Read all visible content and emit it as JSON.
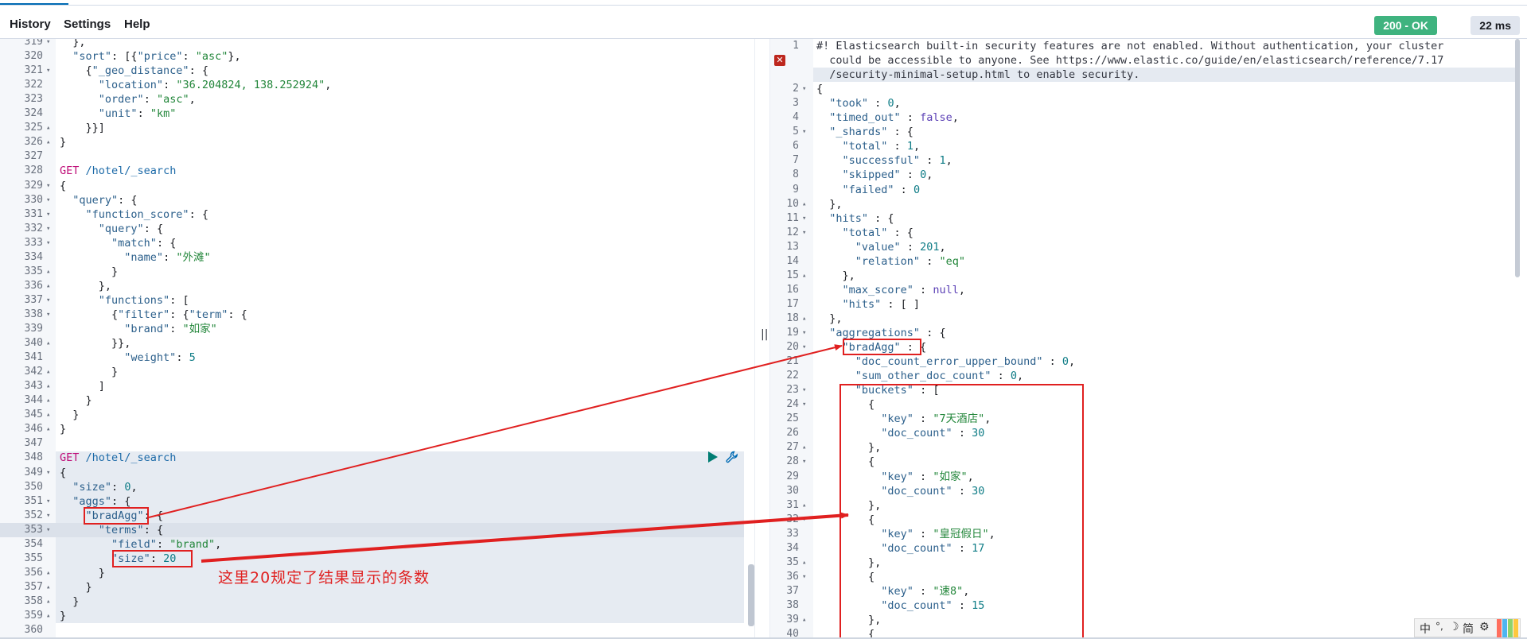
{
  "menu": [
    "History",
    "Settings",
    "Help"
  ],
  "status": {
    "code": "200 - OK",
    "time": "22 ms"
  },
  "divider_glyph": "||",
  "annotation": "这里20规定了结果显示的条数",
  "icons": {
    "run": "play-icon",
    "settings": "wrench-icon",
    "error": "error-marker-icon"
  },
  "ime": [
    "中",
    "°,",
    "☽",
    "简",
    "⚙"
  ],
  "colors": {
    "status_ok": "#3fb37f",
    "annotation": "#e02020",
    "accent": "#006bb4"
  },
  "editor": {
    "lines": [
      {
        "n": "319",
        "fold": "▾",
        "html": "  },"
      },
      {
        "n": "320",
        "fold": "",
        "html": "  <span class='k'>\"sort\"</span>: [{<span class='k'>\"price\"</span>: <span class='s'>\"asc\"</span>},"
      },
      {
        "n": "321",
        "fold": "▾",
        "html": "    {<span class='k'>\"_geo_distance\"</span>: {"
      },
      {
        "n": "322",
        "fold": "",
        "html": "      <span class='k'>\"location\"</span>: <span class='s'>\"36.204824, 138.252924\"</span>,"
      },
      {
        "n": "323",
        "fold": "",
        "html": "      <span class='k'>\"order\"</span>: <span class='s'>\"asc\"</span>,"
      },
      {
        "n": "324",
        "fold": "",
        "html": "      <span class='k'>\"unit\"</span>: <span class='s'>\"km\"</span>"
      },
      {
        "n": "325",
        "fold": "▴",
        "html": "    }}]"
      },
      {
        "n": "326",
        "fold": "▴",
        "html": "}"
      },
      {
        "n": "327",
        "fold": "",
        "html": ""
      },
      {
        "n": "328",
        "fold": "",
        "html": "<span class='m'>GET</span> <span class='u'>/hotel/_search</span>"
      },
      {
        "n": "329",
        "fold": "▾",
        "html": "{"
      },
      {
        "n": "330",
        "fold": "▾",
        "html": "  <span class='k'>\"query\"</span>: {"
      },
      {
        "n": "331",
        "fold": "▾",
        "html": "    <span class='k'>\"function_score\"</span>: {"
      },
      {
        "n": "332",
        "fold": "▾",
        "html": "      <span class='k'>\"query\"</span>: {"
      },
      {
        "n": "333",
        "fold": "▾",
        "html": "        <span class='k'>\"match\"</span>: {"
      },
      {
        "n": "334",
        "fold": "",
        "html": "          <span class='k'>\"name\"</span>: <span class='s'>\"外滩\"</span>"
      },
      {
        "n": "335",
        "fold": "▴",
        "html": "        }"
      },
      {
        "n": "336",
        "fold": "▴",
        "html": "      },"
      },
      {
        "n": "337",
        "fold": "▾",
        "html": "      <span class='k'>\"functions\"</span>: ["
      },
      {
        "n": "338",
        "fold": "▾",
        "html": "        {<span class='k'>\"filter\"</span>: {<span class='k'>\"term\"</span>: {"
      },
      {
        "n": "339",
        "fold": "",
        "html": "          <span class='k'>\"brand\"</span>: <span class='s'>\"如家\"</span>"
      },
      {
        "n": "340",
        "fold": "▴",
        "html": "        }},"
      },
      {
        "n": "341",
        "fold": "",
        "html": "          <span class='k'>\"weight\"</span>: <span class='n'>5</span>"
      },
      {
        "n": "342",
        "fold": "▴",
        "html": "        }"
      },
      {
        "n": "343",
        "fold": "▴",
        "html": "      ]"
      },
      {
        "n": "344",
        "fold": "▴",
        "html": "    }"
      },
      {
        "n": "345",
        "fold": "▴",
        "html": "  }"
      },
      {
        "n": "346",
        "fold": "▴",
        "html": "}"
      },
      {
        "n": "347",
        "fold": "",
        "html": ""
      },
      {
        "n": "348",
        "fold": "",
        "html": "<span class='m'>GET</span> <span class='u'>/hotel/_search</span>"
      },
      {
        "n": "349",
        "fold": "▾",
        "html": "{"
      },
      {
        "n": "350",
        "fold": "",
        "html": "  <span class='k'>\"size\"</span>: <span class='n'>0</span>,"
      },
      {
        "n": "351",
        "fold": "▾",
        "html": "  <span class='k'>\"aggs\"</span>: {"
      },
      {
        "n": "352",
        "fold": "▾",
        "html": "    <span class='k'>\"bradAgg\"</span>: {"
      },
      {
        "n": "353",
        "fold": "▾",
        "html": "      <span class='k'>\"terms\"</span>: {"
      },
      {
        "n": "354",
        "fold": "",
        "html": "        <span class='k'>\"field\"</span>: <span class='s'>\"brand\"</span>,"
      },
      {
        "n": "355",
        "fold": "",
        "html": "        <span class='k'>\"size\"</span>: <span class='n'>20</span>"
      },
      {
        "n": "356",
        "fold": "▴",
        "html": "      }"
      },
      {
        "n": "357",
        "fold": "▴",
        "html": "    }"
      },
      {
        "n": "358",
        "fold": "▴",
        "html": "  }"
      },
      {
        "n": "359",
        "fold": "▴",
        "html": "}"
      },
      {
        "n": "360",
        "fold": "",
        "html": ""
      }
    ]
  },
  "response": {
    "lines": [
      {
        "n": "1",
        "fold": "",
        "html": "<span class='c'>#! Elasticsearch built-in security features are not enabled. Without authentication, your cluster</span>"
      },
      {
        "n": "",
        "fold": "",
        "html": "<span class='c'>  could be accessible to anyone. See https://www.elastic.co/guide/en/elasticsearch/reference/7.17</span>"
      },
      {
        "n": "",
        "fold": "",
        "html": "<span class='c'>  /security-minimal-setup.html to enable security.</span>"
      },
      {
        "n": "2",
        "fold": "▾",
        "html": "{"
      },
      {
        "n": "3",
        "fold": "",
        "html": "  <span class='k'>\"took\"</span> : <span class='n'>0</span>,"
      },
      {
        "n": "4",
        "fold": "",
        "html": "  <span class='k'>\"timed_out\"</span> : <span class='b'>false</span>,"
      },
      {
        "n": "5",
        "fold": "▾",
        "html": "  <span class='k'>\"_shards\"</span> : {"
      },
      {
        "n": "6",
        "fold": "",
        "html": "    <span class='k'>\"total\"</span> : <span class='n'>1</span>,"
      },
      {
        "n": "7",
        "fold": "",
        "html": "    <span class='k'>\"successful\"</span> : <span class='n'>1</span>,"
      },
      {
        "n": "8",
        "fold": "",
        "html": "    <span class='k'>\"skipped\"</span> : <span class='n'>0</span>,"
      },
      {
        "n": "9",
        "fold": "",
        "html": "    <span class='k'>\"failed\"</span> : <span class='n'>0</span>"
      },
      {
        "n": "10",
        "fold": "▴",
        "html": "  },"
      },
      {
        "n": "11",
        "fold": "▾",
        "html": "  <span class='k'>\"hits\"</span> : {"
      },
      {
        "n": "12",
        "fold": "▾",
        "html": "    <span class='k'>\"total\"</span> : {"
      },
      {
        "n": "13",
        "fold": "",
        "html": "      <span class='k'>\"value\"</span> : <span class='n'>201</span>,"
      },
      {
        "n": "14",
        "fold": "",
        "html": "      <span class='k'>\"relation\"</span> : <span class='s'>\"eq\"</span>"
      },
      {
        "n": "15",
        "fold": "▴",
        "html": "    },"
      },
      {
        "n": "16",
        "fold": "",
        "html": "    <span class='k'>\"max_score\"</span> : <span class='b'>null</span>,"
      },
      {
        "n": "17",
        "fold": "",
        "html": "    <span class='k'>\"hits\"</span> : [ ]"
      },
      {
        "n": "18",
        "fold": "▴",
        "html": "  },"
      },
      {
        "n": "19",
        "fold": "▾",
        "html": "  <span class='k'>\"aggregations\"</span> : {"
      },
      {
        "n": "20",
        "fold": "▾",
        "html": "    <span class='k'>\"bradAgg\"</span> : {"
      },
      {
        "n": "21",
        "fold": "",
        "html": "      <span class='k'>\"doc_count_error_upper_bound\"</span> : <span class='n'>0</span>,"
      },
      {
        "n": "22",
        "fold": "",
        "html": "      <span class='k'>\"sum_other_doc_count\"</span> : <span class='n'>0</span>,"
      },
      {
        "n": "23",
        "fold": "▾",
        "html": "      <span class='k'>\"buckets\"</span> : ["
      },
      {
        "n": "24",
        "fold": "▾",
        "html": "        {"
      },
      {
        "n": "25",
        "fold": "",
        "html": "          <span class='k'>\"key\"</span> : <span class='s'>\"7天酒店\"</span>,"
      },
      {
        "n": "26",
        "fold": "",
        "html": "          <span class='k'>\"doc_count\"</span> : <span class='n'>30</span>"
      },
      {
        "n": "27",
        "fold": "▴",
        "html": "        },"
      },
      {
        "n": "28",
        "fold": "▾",
        "html": "        {"
      },
      {
        "n": "29",
        "fold": "",
        "html": "          <span class='k'>\"key\"</span> : <span class='s'>\"如家\"</span>,"
      },
      {
        "n": "30",
        "fold": "",
        "html": "          <span class='k'>\"doc_count\"</span> : <span class='n'>30</span>"
      },
      {
        "n": "31",
        "fold": "▴",
        "html": "        },"
      },
      {
        "n": "32",
        "fold": "▾",
        "html": "        {"
      },
      {
        "n": "33",
        "fold": "",
        "html": "          <span class='k'>\"key\"</span> : <span class='s'>\"皇冠假日\"</span>,"
      },
      {
        "n": "34",
        "fold": "",
        "html": "          <span class='k'>\"doc_count\"</span> : <span class='n'>17</span>"
      },
      {
        "n": "35",
        "fold": "▴",
        "html": "        },"
      },
      {
        "n": "36",
        "fold": "▾",
        "html": "        {"
      },
      {
        "n": "37",
        "fold": "",
        "html": "          <span class='k'>\"key\"</span> : <span class='s'>\"速8\"</span>,"
      },
      {
        "n": "38",
        "fold": "",
        "html": "          <span class='k'>\"doc_count\"</span> : <span class='n'>15</span>"
      },
      {
        "n": "39",
        "fold": "▴",
        "html": "        },"
      },
      {
        "n": "40",
        "fold": "",
        "html": "        {"
      }
    ]
  }
}
